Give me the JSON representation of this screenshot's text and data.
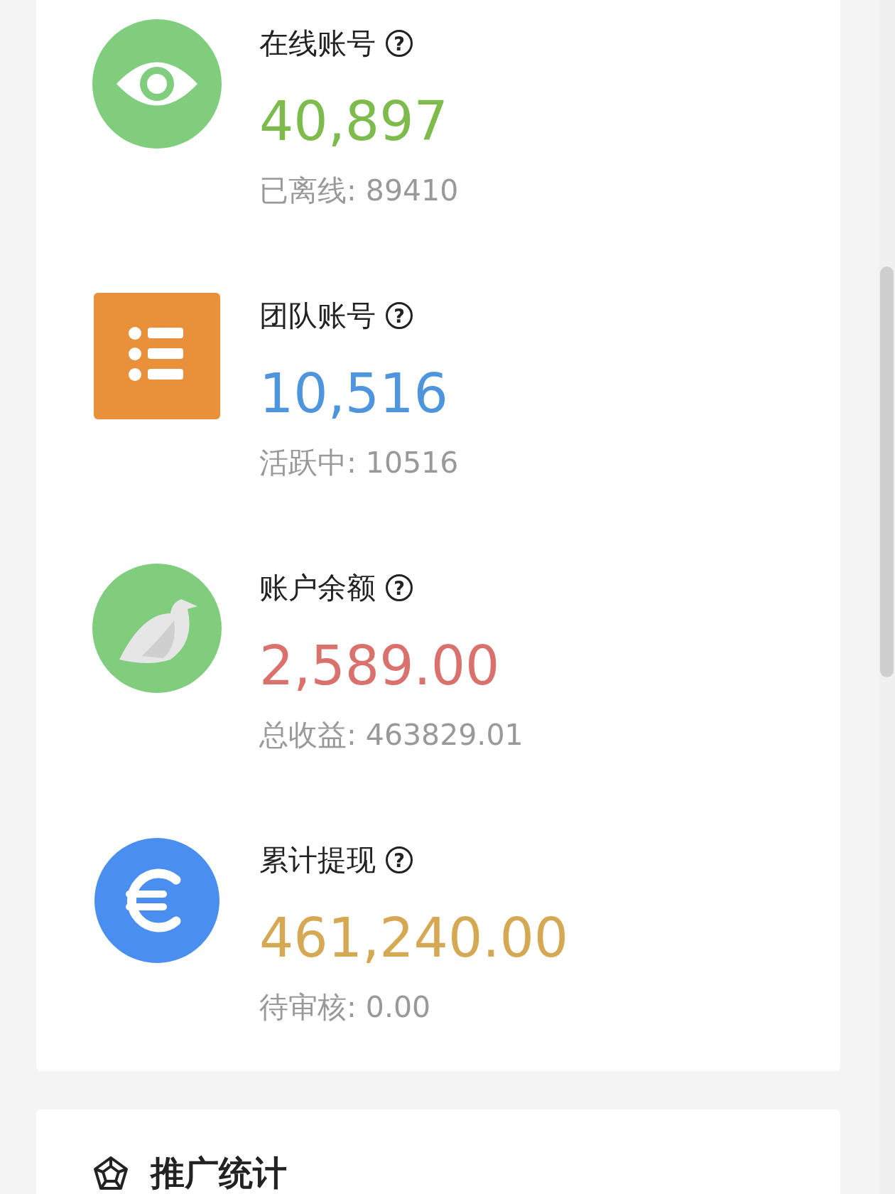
{
  "stats": [
    {
      "kind": "eye",
      "title": "在线账号",
      "help": "?",
      "value": "40,897",
      "color": "#7cbb4c",
      "sub": "已离线: 89410"
    },
    {
      "kind": "list",
      "title": "团队账号",
      "help": "?",
      "value": "10,516",
      "color": "#4f95dd",
      "sub": "活跃中: 10516"
    },
    {
      "kind": "bird",
      "title": "账户余额",
      "help": "?",
      "value": "2,589.00",
      "color": "#d9716c",
      "sub": "总收益: 463829.01"
    },
    {
      "kind": "euro",
      "title": "累计提现",
      "help": "?",
      "value": "461,240.00",
      "color": "#d5a954",
      "sub": "待审核: 0.00"
    }
  ],
  "section": {
    "title": "推广统计"
  }
}
